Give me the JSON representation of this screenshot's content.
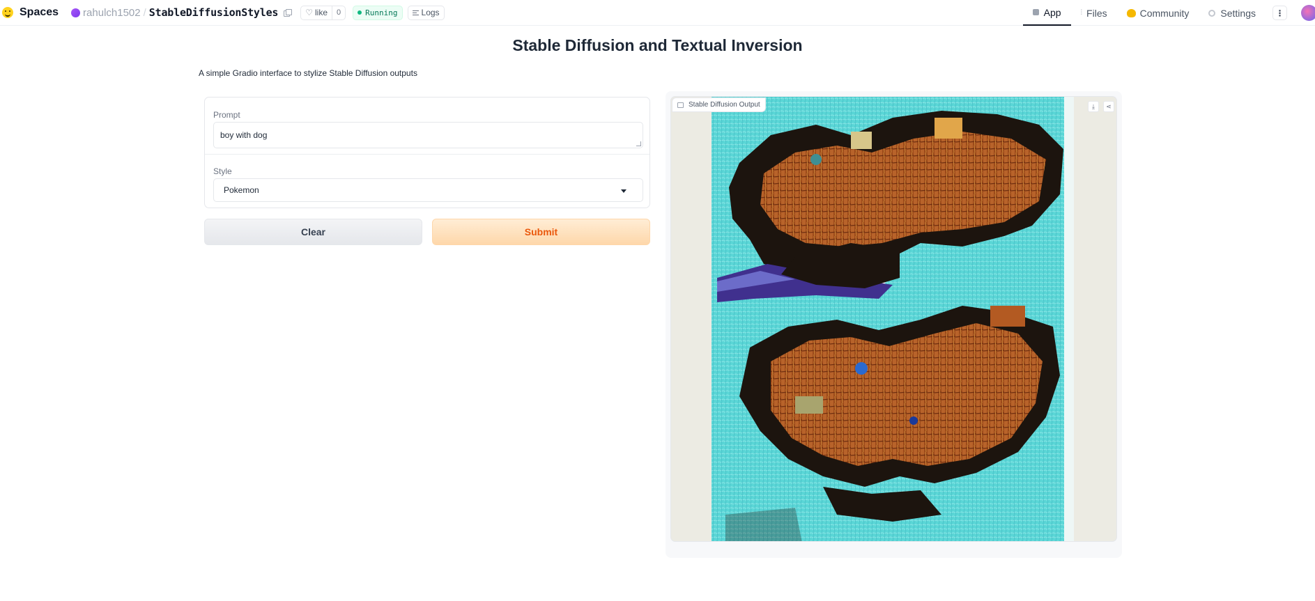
{
  "nav": {
    "brand": "Spaces",
    "owner": "rahulch1502",
    "separator": "/",
    "repo": "StableDiffusionStyles",
    "like_label": "like",
    "like_count": "0",
    "status": "Running",
    "logs_label": "Logs",
    "tabs": [
      {
        "label": "App",
        "icon": "app-icon",
        "active": true
      },
      {
        "label": "Files",
        "icon": "files-icon"
      },
      {
        "label": "Community",
        "icon": "community-icon"
      },
      {
        "label": "Settings",
        "icon": "settings-icon"
      }
    ],
    "menu_icon": "more-vertical-icon"
  },
  "app": {
    "title": "Stable Diffusion and Textual Inversion",
    "description": "A simple Gradio interface to stylize Stable Diffusion outputs",
    "prompt": {
      "label": "Prompt",
      "value": "boy with dog"
    },
    "style": {
      "label": "Style",
      "value": "Pokemon"
    },
    "clear_label": "Clear",
    "submit_label": "Submit",
    "output": {
      "label": "Stable Diffusion Output",
      "download_icon": "download-icon",
      "share_icon": "share-icon"
    }
  },
  "colors": {
    "submit_text": "#ea580c",
    "submit_bg": "#fed7aa",
    "status_green": "#10b981",
    "image_sky": "#57d3d4"
  }
}
